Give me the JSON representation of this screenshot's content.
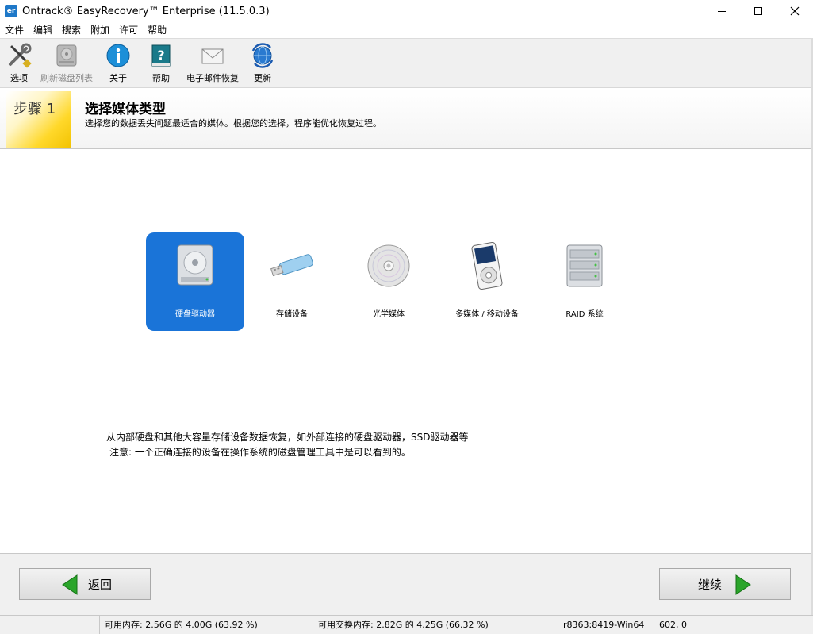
{
  "window": {
    "icon_text": "er",
    "title": "Ontrack® EasyRecovery™ Enterprise (11.5.0.3)"
  },
  "menu": [
    "文件",
    "编辑",
    "搜索",
    "附加",
    "许可",
    "帮助"
  ],
  "toolbar": {
    "options": "选项",
    "refresh": "刷新磁盘列表",
    "about": "关于",
    "help": "帮助",
    "email": "电子邮件恢复",
    "update": "更新"
  },
  "step": {
    "badge": "步骤 1",
    "title": "选择媒体类型",
    "description": "选择您的数据丢失问题最适合的媒体。根据您的选择，程序能优化恢复过程。"
  },
  "media": [
    {
      "label": "硬盘驱动器",
      "icon": "hard-drive-icon",
      "selected": true
    },
    {
      "label": "存储设备",
      "icon": "usb-drive-icon",
      "selected": false
    },
    {
      "label": "光学媒体",
      "icon": "optical-disc-icon",
      "selected": false
    },
    {
      "label": "多媒体 / 移动设备",
      "icon": "media-player-icon",
      "selected": false
    },
    {
      "label": "RAID 系统",
      "icon": "raid-icon",
      "selected": false
    }
  ],
  "description": {
    "line1": "从内部硬盘和其他大容量存储设备数据恢复，如外部连接的硬盘驱动器，SSD驱动器等",
    "line2": "注意: 一个正确连接的设备在操作系统的磁盘管理工具中是可以看到的。"
  },
  "nav": {
    "back": "返回",
    "next": "继续"
  },
  "status": {
    "memory": "可用内存: 2.56G 的 4.00G (63.92 %)",
    "swap": "可用交换内存: 2.82G 的 4.25G (66.32 %)",
    "build": "r8363:8419-Win64",
    "coords": "602, 0"
  },
  "colors": {
    "selection": "#1a74d8",
    "step_badge": "#ffd82a",
    "nav_arrow": "#2aa52a"
  }
}
